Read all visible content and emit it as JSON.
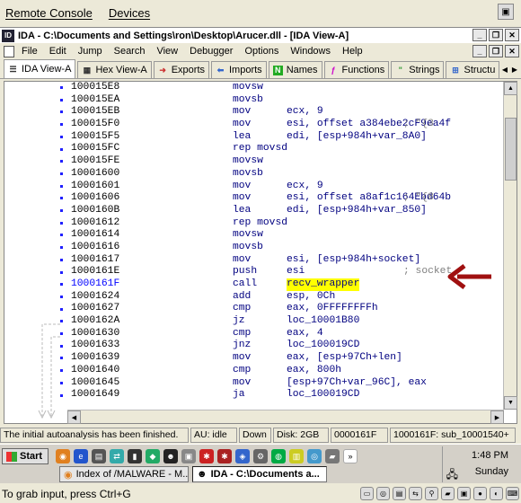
{
  "remote_menu": {
    "items": [
      "Remote Console",
      "Devices"
    ]
  },
  "ida_title": "IDA - C:\\Documents and Settings\\ron\\Desktop\\Arucer.dll - [IDA View-A]",
  "ida_menu": [
    "File",
    "Edit",
    "Jump",
    "Search",
    "View",
    "Debugger",
    "Options",
    "Windows",
    "Help"
  ],
  "tabs": [
    {
      "label": "IDA View-A",
      "icon": "ida-view-icon",
      "active": true
    },
    {
      "label": "Hex View-A",
      "icon": "hex-view-icon"
    },
    {
      "label": "Exports",
      "icon": "exports-icon"
    },
    {
      "label": "Imports",
      "icon": "imports-icon"
    },
    {
      "label": "Names",
      "icon": "names-icon"
    },
    {
      "label": "Functions",
      "icon": "functions-icon"
    },
    {
      "label": "Strings",
      "icon": "strings-icon"
    },
    {
      "label": "Structu",
      "icon": "structures-icon"
    }
  ],
  "listing": [
    {
      "addr": "100015E8",
      "mn": "movsw",
      "op": "",
      "cm": ""
    },
    {
      "addr": "100015EA",
      "mn": "movsb",
      "op": "",
      "cm": ""
    },
    {
      "addr": "100015EB",
      "mn": "mov",
      "op": "ecx, 9",
      "cm": ""
    },
    {
      "addr": "100015F0",
      "mn": "mov",
      "op": "esi, offset a384ebe2cF9ea4f",
      "cm": "; \"{3"
    },
    {
      "addr": "100015F5",
      "mn": "lea",
      "op": "edi, [esp+984h+var_8A0]",
      "cm": ""
    },
    {
      "addr": "100015FC",
      "mn": "rep movsd",
      "op": "",
      "cm": ""
    },
    {
      "addr": "100015FE",
      "mn": "movsw",
      "op": "",
      "cm": ""
    },
    {
      "addr": "10001600",
      "mn": "movsb",
      "op": "",
      "cm": ""
    },
    {
      "addr": "10001601",
      "mn": "mov",
      "op": "ecx, 9",
      "cm": ""
    },
    {
      "addr": "10001606",
      "mn": "mov",
      "op": "esi, offset a8af1c164Ebd64b",
      "cm": "; \"{8"
    },
    {
      "addr": "1000160B",
      "mn": "lea",
      "op": "edi, [esp+984h+var_850]",
      "cm": ""
    },
    {
      "addr": "10001612",
      "mn": "rep movsd",
      "op": "",
      "cm": ""
    },
    {
      "addr": "10001614",
      "mn": "movsw",
      "op": "",
      "cm": ""
    },
    {
      "addr": "10001616",
      "mn": "movsb",
      "op": "",
      "cm": ""
    },
    {
      "addr": "10001617",
      "mn": "mov",
      "op": "esi, [esp+984h+socket]",
      "cm": ""
    },
    {
      "addr": "1000161E",
      "mn": "push",
      "op": "esi",
      "cm": "; socket"
    },
    {
      "addr": "1000161F",
      "mn": "call",
      "op": "recv_wrapper",
      "cm": "",
      "current": true
    },
    {
      "addr": "10001624",
      "mn": "add",
      "op": "esp, 0Ch",
      "cm": ""
    },
    {
      "addr": "10001627",
      "mn": "cmp",
      "op": "eax, 0FFFFFFFFh",
      "cm": ""
    },
    {
      "addr": "1000162A",
      "mn": "jz",
      "op": "loc_10001B80",
      "cm": ""
    },
    {
      "addr": "10001630",
      "mn": "cmp",
      "op": "eax, 4",
      "cm": ""
    },
    {
      "addr": "10001633",
      "mn": "jnz",
      "op": "loc_100019CD",
      "cm": ""
    },
    {
      "addr": "10001639",
      "mn": "mov",
      "op": "eax, [esp+97Ch+len]",
      "cm": ""
    },
    {
      "addr": "10001640",
      "mn": "cmp",
      "op": "eax, 800h",
      "cm": ""
    },
    {
      "addr": "10001645",
      "mn": "mov",
      "op": "[esp+97Ch+var_96C], eax",
      "cm": ""
    },
    {
      "addr": "10001649",
      "mn": "ja",
      "op": "loc_100019CD",
      "cm": ""
    }
  ],
  "status": {
    "message": "The initial autoanalysis has been finished.",
    "au": "AU:  idle",
    "dir": "Down",
    "disk": "Disk: 2GB",
    "cur_addr": "0000161F",
    "location": "1000161F: sub_10001540+"
  },
  "taskbar": {
    "start": "Start",
    "tasks": [
      "Index of /MALWARE - M...",
      "IDA - C:\\Documents a..."
    ],
    "time": "1:48 PM",
    "day": "Sunday"
  },
  "bottom_hint": "To grab input, press Ctrl+G",
  "colors": {
    "highlight": "#ffff00",
    "annotation_arrow": "#a01010",
    "code_text": "#000080",
    "current_addr": "#0000ff"
  }
}
